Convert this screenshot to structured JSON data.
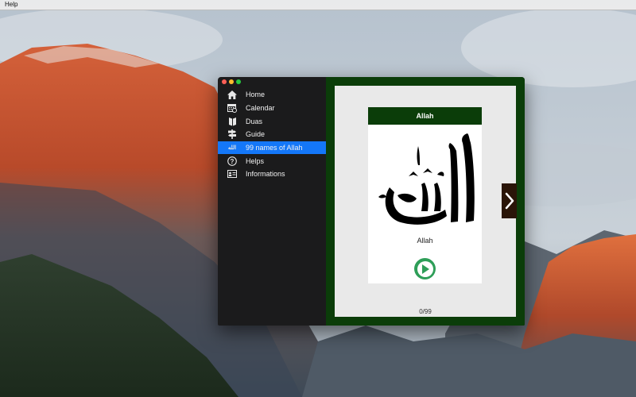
{
  "menubar": {
    "help_label": "Help"
  },
  "sidebar": {
    "items": [
      {
        "label": "Home",
        "icon": "home-icon",
        "active": false
      },
      {
        "label": "Calendar",
        "icon": "calendar-icon",
        "active": false
      },
      {
        "label": "Duas",
        "icon": "book-icon",
        "active": false
      },
      {
        "label": "Guide",
        "icon": "signpost-icon",
        "active": false
      },
      {
        "label": "99 names of Allah",
        "icon": "allah-icon",
        "active": true
      },
      {
        "label": "Helps",
        "icon": "question-icon",
        "active": false
      },
      {
        "label": "Informations",
        "icon": "id-card-icon",
        "active": false
      }
    ],
    "active_color": "#1477f8"
  },
  "card": {
    "title": "Allah",
    "caption": "Allah",
    "play_color": "#2e9e58"
  },
  "counter": "0/99",
  "colors": {
    "frame_green": "#0b3d09",
    "sidebar_bg": "#1b1b1c"
  }
}
